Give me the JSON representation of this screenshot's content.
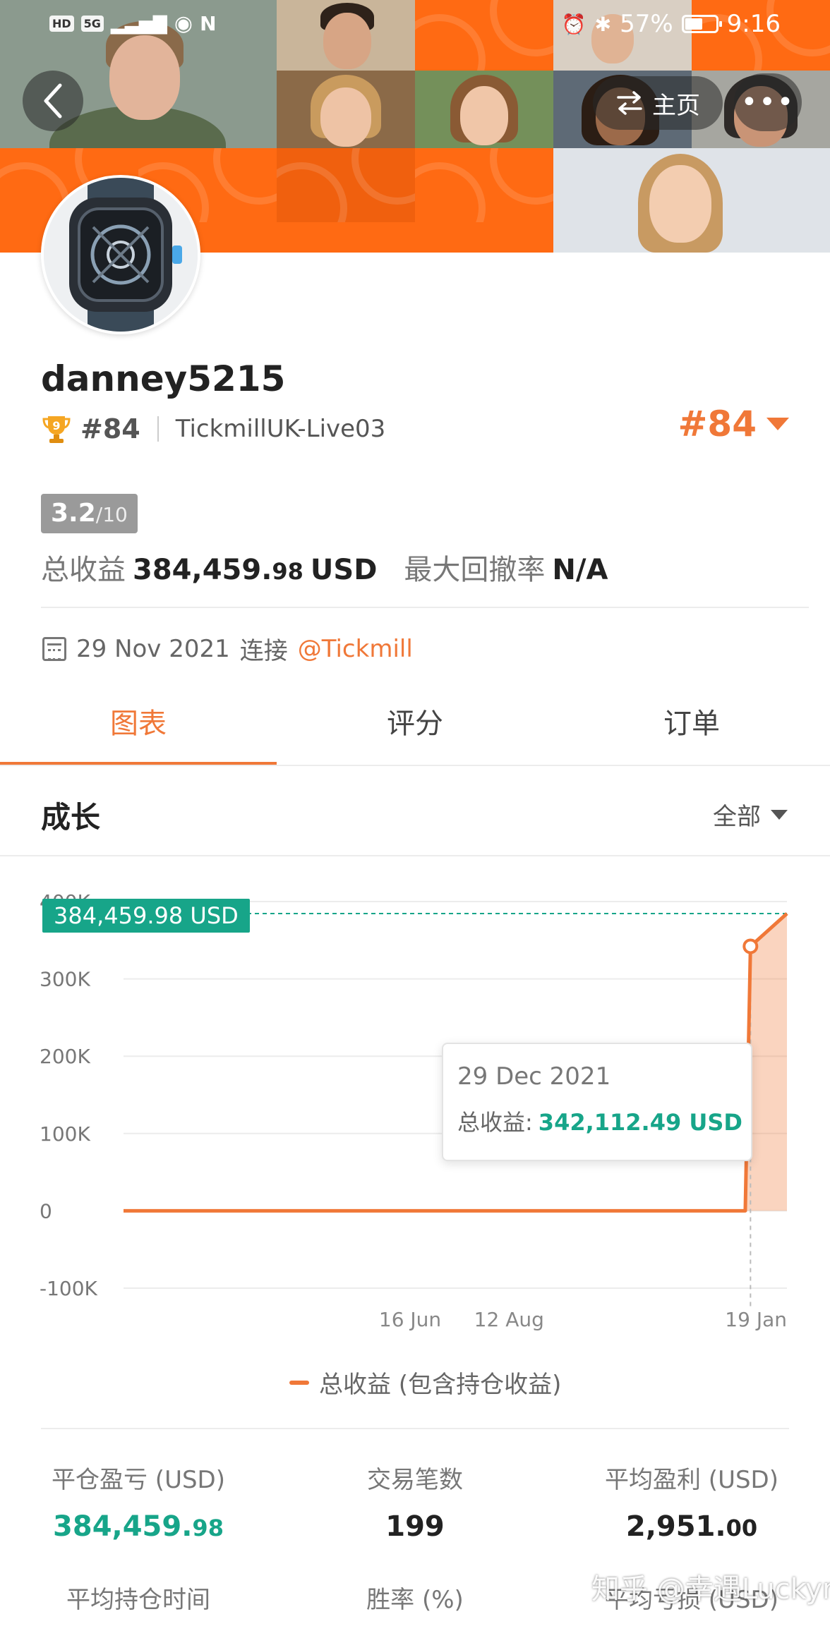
{
  "status_bar": {
    "left_chips": [
      "HD",
      "5G"
    ],
    "battery": "57%",
    "time": "9:16"
  },
  "header": {
    "back_icon": "chevron-left-icon",
    "home_label": "主页",
    "home_icon": "swap-icon",
    "more_icon": "more-dots-icon",
    "more_glyph": "•••"
  },
  "profile": {
    "username": "danney5215",
    "rank_badge_number": "9",
    "rank_small": "#84",
    "server": "TickmillUK-Live03",
    "rank_big": "#84",
    "score_main": "3.2",
    "score_sub": "/10",
    "total_profit_label": "总收益",
    "total_profit_int": "384,459.",
    "total_profit_dec": "98",
    "total_profit_unit": "USD",
    "max_drawdown_label": "最大回撤率",
    "max_drawdown_value": "N/A",
    "connect_date": "29 Nov 2021",
    "connect_label": "连接",
    "broker": "@Tickmill"
  },
  "tabs": [
    {
      "label": "图表",
      "active": true
    },
    {
      "label": "评分",
      "active": false
    },
    {
      "label": "订单",
      "active": false
    }
  ],
  "section": {
    "title": "成长",
    "range": "全部"
  },
  "chart_data": {
    "type": "area",
    "x_ticks": [
      "16 Jun",
      "12 Aug",
      "19 Jan"
    ],
    "y_ticks": [
      "400K",
      "300K",
      "200K",
      "100K",
      "0",
      "-100K"
    ],
    "ylim": [
      -100000,
      400000
    ],
    "series": [
      {
        "name": "总收益 (包含持仓收益)",
        "color": "#f07838",
        "points": [
          {
            "x": "29 Nov 2021",
            "y": 0
          },
          {
            "x": "26 Dec 2021",
            "y": 0
          },
          {
            "x": "29 Dec 2021",
            "y": 342112.49
          },
          {
            "x": "19 Jan 2022",
            "y": 384459.98
          }
        ]
      }
    ],
    "current_value_label": "384,459.98 USD",
    "tooltip": {
      "date": "29 Dec 2021",
      "label": "总收益:",
      "value": "342,112.49 USD"
    },
    "legend": "总收益 (包含持仓收益)",
    "grid": true
  },
  "metrics": [
    {
      "label": "平仓盈亏 (USD)",
      "int": "384,459.",
      "dec": "98",
      "green": true
    },
    {
      "label": "交易笔数",
      "int": "199",
      "dec": "",
      "green": false
    },
    {
      "label": "平均盈利 (USD)",
      "int": "2,951.",
      "dec": "00",
      "green": false
    }
  ],
  "metrics_row2": [
    "平均持仓时间",
    "胜率 (%)",
    "平均亏损 (USD)"
  ],
  "watermark": "知乎 @幸遇Luckyny",
  "colors": {
    "accent": "#f07838",
    "banner_orange": "#ff6a13",
    "positive": "#17a589"
  }
}
